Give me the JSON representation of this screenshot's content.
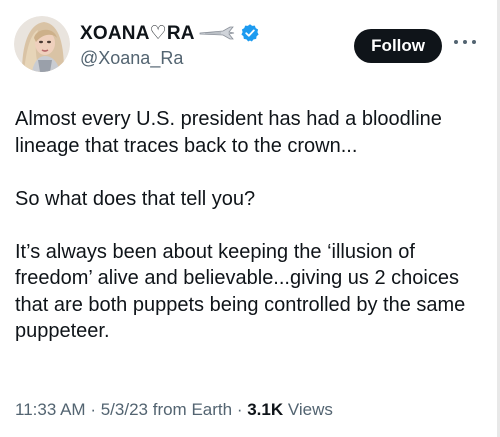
{
  "tweet": {
    "author": {
      "display_name": "XOANA♡RA",
      "handle": "@Xoana_Ra",
      "verified": true
    },
    "follow_label": "Follow",
    "paragraphs": [
      "Almost every U.S. president has had a bloodline lineage that traces back to the crown...",
      "So what does that tell you?",
      "It’s always been about keeping the ‘illusion of freedom’ alive and believable...giving us 2 choices that are both puppets being controlled by the same puppeteer."
    ],
    "time": "11:33 AM",
    "date": "5/3/23",
    "source": "from Earth",
    "separator": "·",
    "views_count": "3.1K",
    "views_label": "Views"
  },
  "icons": {
    "verified": "verified-badge-icon",
    "more": "more-options-icon",
    "name_decoration": "airplane-emoji-icon"
  },
  "colors": {
    "text_primary": "#0f1419",
    "text_secondary": "#536471",
    "verified_blue": "#1d9bf0",
    "follow_bg": "#0f1419",
    "follow_text": "#ffffff"
  }
}
